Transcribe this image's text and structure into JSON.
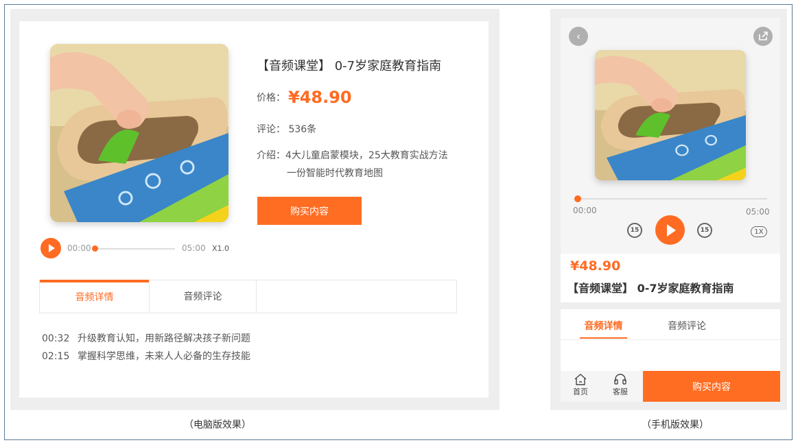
{
  "desktop": {
    "title": "【音频课堂】 0-7岁家庭教育指南",
    "price_label": "价格：",
    "price": "¥48.90",
    "comment_text": "评论： 536条",
    "intro_line1": "介绍：4大儿童启蒙模块，25大教育实战方法",
    "intro_line2": "一份智能时代教育地图",
    "buy_label": "购买内容",
    "player": {
      "current": "00:00",
      "total": "05:00",
      "speed": "X1.0",
      "progress": 0
    },
    "tabs": [
      "音频详情",
      "音频评论"
    ],
    "chapters": [
      {
        "time": "00:32",
        "title": "升级教育认知，用新路径解决孩子新问题"
      },
      {
        "time": "02:15",
        "title": "掌握科学思维，未来人人必备的生存技能"
      }
    ],
    "caption": "（电脑版效果）"
  },
  "mobile": {
    "player": {
      "current": "00:00",
      "total": "05:00",
      "rewind": "15",
      "forward": "15",
      "speed": "1X",
      "progress": 0
    },
    "price": "¥48.90",
    "title": "【音频课堂】 0-7岁家庭教育指南",
    "tabs": [
      "音频详情",
      "音频评论"
    ],
    "nav": {
      "home": "首页",
      "service": "客服"
    },
    "buy_label": "购买内容",
    "caption": "（手机版效果）"
  },
  "colors": {
    "accent": "#ff6b22",
    "panel": "#eeeeee"
  }
}
